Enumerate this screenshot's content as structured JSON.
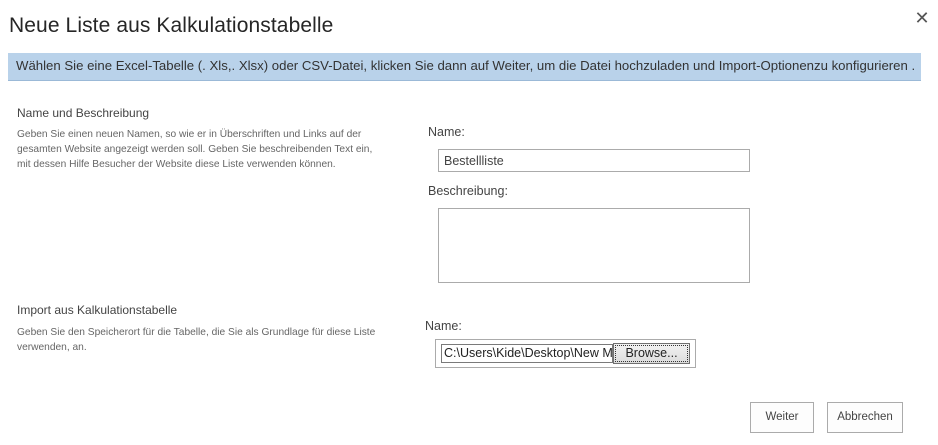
{
  "dialog": {
    "title": "Neue Liste aus Kalkulationstabelle",
    "close_icon": "close-icon",
    "info": "Wählen Sie eine Excel-Tabelle (. Xls,. Xlsx) oder CSV-Datei, klicken Sie dann auf Weiter, um die Datei hochzuladen und Import-Optionenzu konfigurieren ."
  },
  "name_section": {
    "title": "Name und Beschreibung",
    "description": "Geben Sie einen neuen Namen, so wie er in Überschriften und Links auf der gesamten Website angezeigt werden soll. Geben Sie beschreibenden Text ein, mit dessen Hilfe Besucher der Website diese Liste verwenden können.",
    "name_label": "Name:",
    "name_value": "Bestellliste",
    "description_label": "Beschreibung:",
    "description_value": ""
  },
  "import_section": {
    "title": "Import aus Kalkulationstabelle",
    "description": "Geben Sie den Speicherort für die Tabelle, die Sie als Grundlage für diese Liste verwenden, an.",
    "file_label": "Name:",
    "file_path": "C:\\Users\\Kide\\Desktop\\New Microsoft Excel Worksheet.xlsx",
    "browse_label": "Browse..."
  },
  "footer": {
    "next_label": "Weiter",
    "cancel_label": "Abbrechen"
  }
}
